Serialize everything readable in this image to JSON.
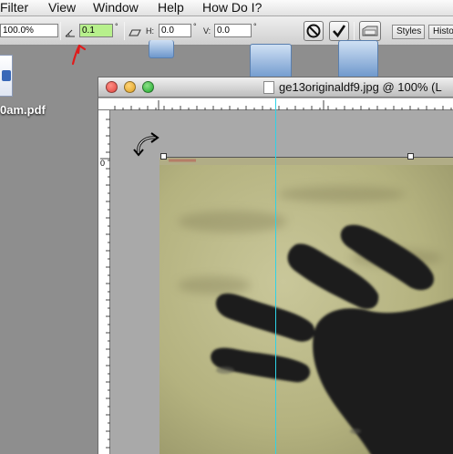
{
  "menubar": {
    "items": [
      {
        "label": "Filter"
      },
      {
        "label": "View"
      },
      {
        "label": "Window"
      },
      {
        "label": "Help"
      },
      {
        "label": "How Do I?"
      }
    ]
  },
  "options": {
    "zoom_value": "100.0%",
    "angle_value": "0.1",
    "degree_symbol": "°",
    "h_label": "H:",
    "h_value": "0.0",
    "v_label": "V:",
    "v_value": "0.0",
    "tab_styles": "Styles",
    "tab_history": "Histo"
  },
  "desktop": {
    "file_label": "0am.pdf"
  },
  "document": {
    "title": "ge13originaldf9.jpg @ 100% (L"
  },
  "ruler": {
    "v_zero": "0"
  },
  "colors": {
    "guide": "#2fd2e6",
    "angle_field": "#b7f08c",
    "close": "#e0443e",
    "minimize": "#dea123",
    "zoom": "#1aab29",
    "annotation": "#e01b1b"
  }
}
